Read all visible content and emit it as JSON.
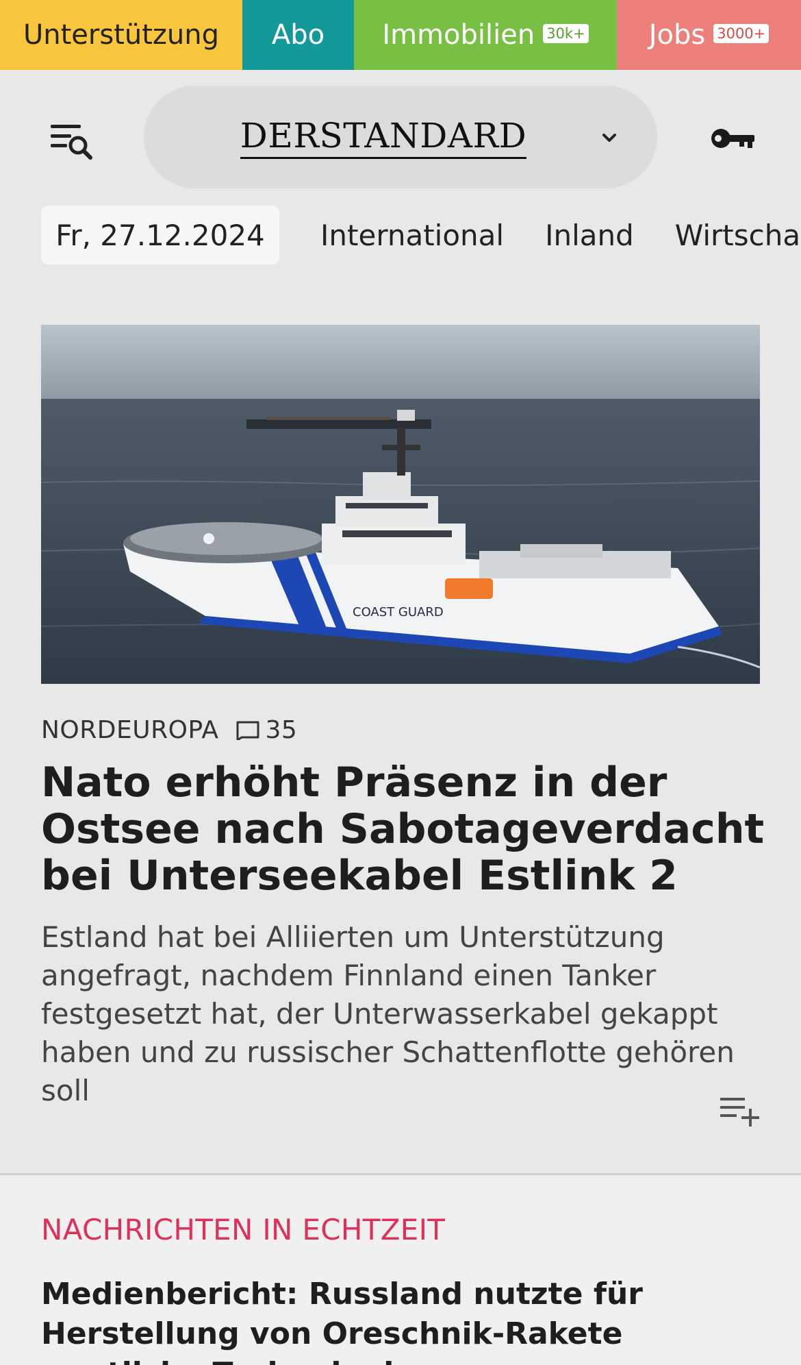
{
  "topbar": {
    "support": "Unterstützung",
    "abo": "Abo",
    "immobilien": "Immobilien",
    "immobilien_badge": "30k+",
    "jobs": "Jobs",
    "jobs_badge": "3000+"
  },
  "header": {
    "logo": "DERSTANDARD",
    "icons": [
      "menu-search-icon",
      "chevron-down-icon",
      "key-icon"
    ]
  },
  "nav": {
    "date": "Fr, 27.12.2024",
    "items": [
      "International",
      "Inland",
      "Wirtschaft"
    ]
  },
  "article": {
    "image_alt_icon": "coast-guard-ship-photo",
    "kicker": "NORDEUROPA",
    "comments": "35",
    "headline": "Nato erhöht Präsenz in der Ostsee nach Sabotageverdacht bei Unterseekabel Estlink 2",
    "teaser": "Estland hat bei Alliierten um Unterstützung angefragt, nachdem Finnland einen Tanker festgesetzt hat, der Unterwasserkabel gekappt haben und zu russischer Schattenflotte gehören soll"
  },
  "live": {
    "label": "NACHRICHTEN IN ECHTZEIT",
    "headline": "Medienbericht: Russland nutzte für Herstellung von Oreschnik-Rakete westliche Technologie"
  },
  "colors": {
    "support": "#f9c53c",
    "abo": "#13999a",
    "immobilien": "#77c043",
    "jobs": "#ec7f7a",
    "live_accent": "#e0305a"
  }
}
